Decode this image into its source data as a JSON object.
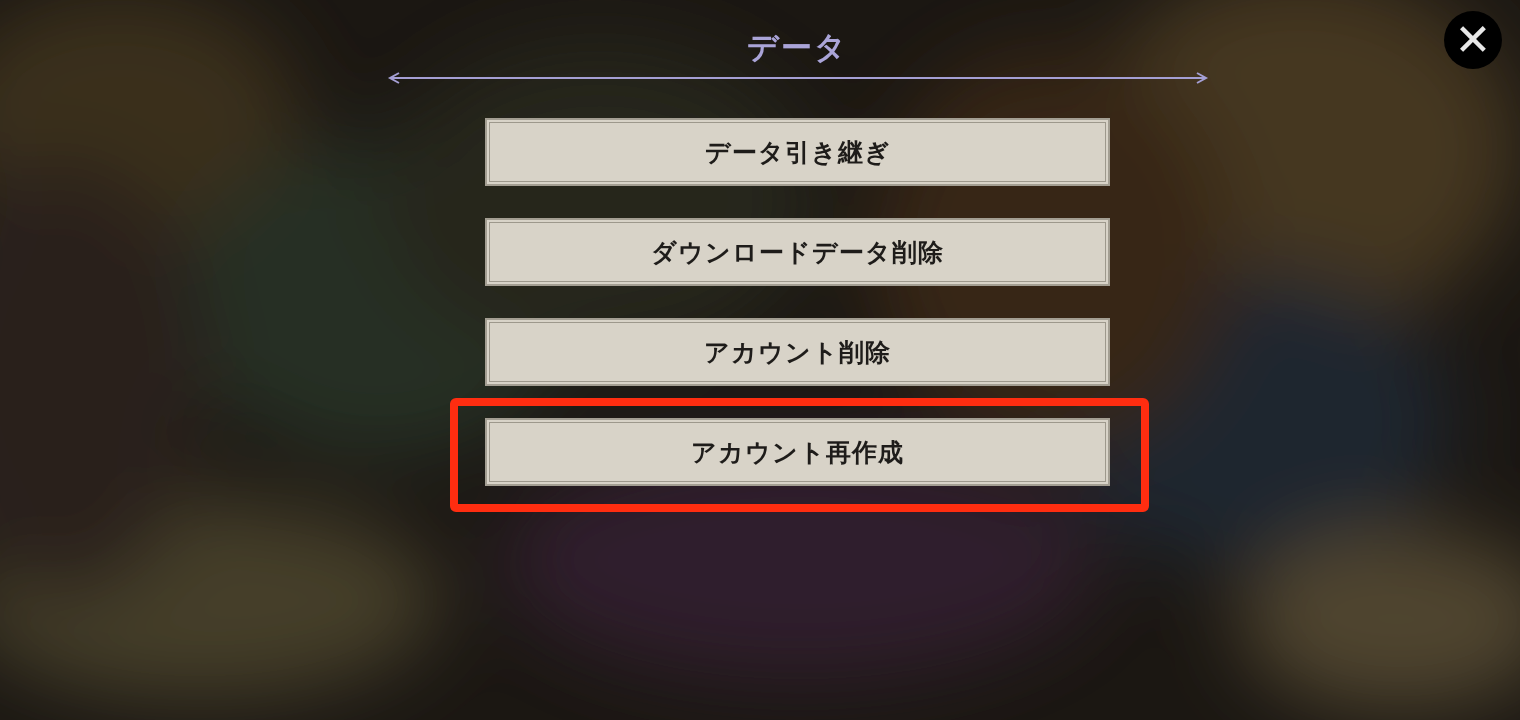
{
  "dialog": {
    "title": "データ",
    "close_label": "✕"
  },
  "buttons": [
    {
      "label": "データ引き継ぎ",
      "highlighted": false
    },
    {
      "label": "ダウンロードデータ削除",
      "highlighted": false
    },
    {
      "label": "アカウント削除",
      "highlighted": false
    },
    {
      "label": "アカウント再作成",
      "highlighted": true
    }
  ]
}
